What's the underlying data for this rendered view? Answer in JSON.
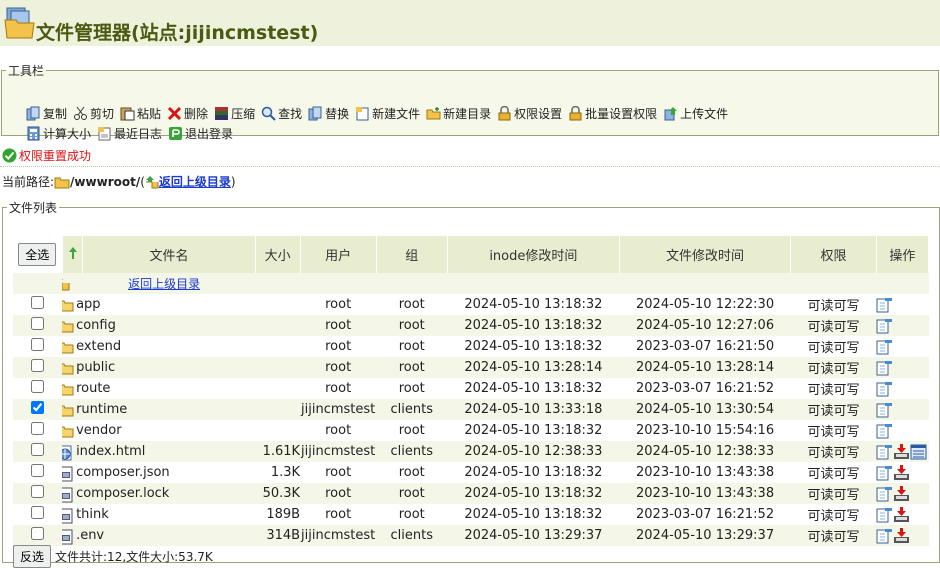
{
  "header": {
    "title": "文件管理器(站点:jijincmstest)"
  },
  "toolbar": {
    "legend": "工具栏",
    "row1": [
      {
        "name": "copy",
        "label": "复制",
        "icon": "copy-icon"
      },
      {
        "name": "cut",
        "label": "剪切",
        "icon": "scissors-icon"
      },
      {
        "name": "paste",
        "label": "粘贴",
        "icon": "paste-icon"
      },
      {
        "name": "delete",
        "label": "删除",
        "icon": "delete-icon"
      },
      {
        "name": "compress",
        "label": "压缩",
        "icon": "archive-icon"
      },
      {
        "name": "find",
        "label": "查找",
        "icon": "search-icon"
      },
      {
        "name": "replace",
        "label": "替换",
        "icon": "replace-icon"
      },
      {
        "name": "new-file",
        "label": "新建文件",
        "icon": "new-file-icon"
      },
      {
        "name": "new-folder",
        "label": "新建目录",
        "icon": "new-folder-icon"
      },
      {
        "name": "permissions",
        "label": "权限设置",
        "icon": "lock-icon"
      },
      {
        "name": "batch-permissions",
        "label": "批量设置权限",
        "icon": "lock-icon"
      },
      {
        "name": "upload",
        "label": "上传文件",
        "icon": "upload-icon"
      }
    ],
    "row2": [
      {
        "name": "calc-size",
        "label": "计算大小",
        "icon": "calculator-icon"
      },
      {
        "name": "recent-log",
        "label": "最近日志",
        "icon": "log-icon"
      },
      {
        "name": "logout",
        "label": "退出登录",
        "icon": "logout-icon"
      }
    ]
  },
  "status": {
    "message": "权限重置成功",
    "color": "#dd1111"
  },
  "path": {
    "label": "当前路径:",
    "value": "/wwwroot/",
    "up_label": "返回上级目录"
  },
  "filelist": {
    "legend": "文件列表",
    "select_all": "全选",
    "invert": "反选",
    "columns": [
      "文件名",
      "大小",
      "用户",
      "组",
      "inode修改时间",
      "文件修改时间",
      "权限",
      "操作"
    ],
    "parent_link": "返回上级目录",
    "rows": [
      {
        "name": "app",
        "type": "folder",
        "size": "",
        "user": "root",
        "group": "root",
        "inode": "2024-05-10 13:18:32",
        "mtime": "2024-05-10 12:22:30",
        "perm": "可读可写",
        "checked": false,
        "ops": [
          "edit"
        ]
      },
      {
        "name": "config",
        "type": "folder",
        "size": "",
        "user": "root",
        "group": "root",
        "inode": "2024-05-10 13:18:32",
        "mtime": "2024-05-10 12:27:06",
        "perm": "可读可写",
        "checked": false,
        "ops": [
          "edit"
        ]
      },
      {
        "name": "extend",
        "type": "folder",
        "size": "",
        "user": "root",
        "group": "root",
        "inode": "2024-05-10 13:18:32",
        "mtime": "2023-03-07 16:21:50",
        "perm": "可读可写",
        "checked": false,
        "ops": [
          "edit"
        ]
      },
      {
        "name": "public",
        "type": "folder",
        "size": "",
        "user": "root",
        "group": "root",
        "inode": "2024-05-10 13:28:14",
        "mtime": "2024-05-10 13:28:14",
        "perm": "可读可写",
        "checked": false,
        "ops": [
          "edit"
        ]
      },
      {
        "name": "route",
        "type": "folder",
        "size": "",
        "user": "root",
        "group": "root",
        "inode": "2024-05-10 13:18:32",
        "mtime": "2023-03-07 16:21:52",
        "perm": "可读可写",
        "checked": false,
        "ops": [
          "edit"
        ]
      },
      {
        "name": "runtime",
        "type": "folder",
        "size": "",
        "user": "jijincmstest",
        "group": "clients",
        "inode": "2024-05-10 13:33:18",
        "mtime": "2024-05-10 13:30:54",
        "perm": "可读可写",
        "checked": true,
        "ops": [
          "edit"
        ]
      },
      {
        "name": "vendor",
        "type": "folder",
        "size": "",
        "user": "root",
        "group": "root",
        "inode": "2024-05-10 13:18:32",
        "mtime": "2023-10-10 15:54:16",
        "perm": "可读可写",
        "checked": false,
        "ops": [
          "edit"
        ]
      },
      {
        "name": "index.html",
        "type": "html",
        "size": "1.61K",
        "user": "jijincmstest",
        "group": "clients",
        "inode": "2024-05-10 12:38:33",
        "mtime": "2024-05-10 12:38:33",
        "perm": "可读可写",
        "checked": false,
        "ops": [
          "edit",
          "download",
          "view"
        ]
      },
      {
        "name": "composer.json",
        "type": "file",
        "size": "1.3K",
        "user": "root",
        "group": "root",
        "inode": "2024-05-10 13:18:32",
        "mtime": "2023-10-10 13:43:38",
        "perm": "可读可写",
        "checked": false,
        "ops": [
          "edit",
          "download"
        ]
      },
      {
        "name": "composer.lock",
        "type": "file",
        "size": "50.3K",
        "user": "root",
        "group": "root",
        "inode": "2024-05-10 13:18:32",
        "mtime": "2023-10-10 13:43:38",
        "perm": "可读可写",
        "checked": false,
        "ops": [
          "edit",
          "download"
        ]
      },
      {
        "name": "think",
        "type": "file",
        "size": "189B",
        "user": "root",
        "group": "root",
        "inode": "2024-05-10 13:18:32",
        "mtime": "2023-03-07 16:21:52",
        "perm": "可读可写",
        "checked": false,
        "ops": [
          "edit",
          "download"
        ]
      },
      {
        "name": ".env",
        "type": "file",
        "size": "314B",
        "user": "jijincmstest",
        "group": "clients",
        "inode": "2024-05-10 13:29:37",
        "mtime": "2024-05-10 13:29:37",
        "perm": "可读可写",
        "checked": false,
        "ops": [
          "edit",
          "download"
        ]
      }
    ],
    "summary": "文件共计:12,文件大小:53.7K"
  }
}
